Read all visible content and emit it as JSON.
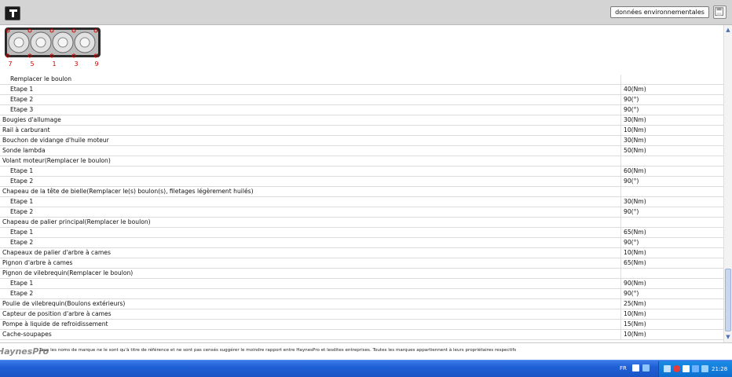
{
  "toolbar": {
    "env_button_label": "données environnementales",
    "logo_icon": "haynes-logo-icon",
    "save_icon": "save-icon"
  },
  "diagram": {
    "labels": [
      "7",
      "5",
      "1",
      "3",
      "9"
    ]
  },
  "rows": [
    {
      "name": "Remplacer le boulon",
      "value": "",
      "sub": true
    },
    {
      "name": "Etape 1",
      "value": "40(Nm)",
      "sub": true
    },
    {
      "name": "Etape 2",
      "value": "90(°)",
      "sub": true
    },
    {
      "name": "Etape 3",
      "value": "90(°)",
      "sub": true
    },
    {
      "name": "Bougies d'allumage",
      "value": "30(Nm)",
      "sub": false
    },
    {
      "name": "Rail à carburant",
      "value": "10(Nm)",
      "sub": false
    },
    {
      "name": "Bouchon de vidange d'huile moteur",
      "value": "30(Nm)",
      "sub": false
    },
    {
      "name": "Sonde lambda",
      "value": "50(Nm)",
      "sub": false
    },
    {
      "name": "Volant moteur(Remplacer le boulon)",
      "value": "",
      "sub": false
    },
    {
      "name": "Etape 1",
      "value": "60(Nm)",
      "sub": true
    },
    {
      "name": "Etape 2",
      "value": "90(°)",
      "sub": true
    },
    {
      "name": "Chapeau de la tête de bielle(Remplacer le(s) boulon(s), filetages légèrement huilés)",
      "value": "",
      "sub": false
    },
    {
      "name": "Etape 1",
      "value": "30(Nm)",
      "sub": true
    },
    {
      "name": "Etape 2",
      "value": "90(°)",
      "sub": true
    },
    {
      "name": "Chapeau de palier principal(Remplacer le boulon)",
      "value": "",
      "sub": false
    },
    {
      "name": "Etape 1",
      "value": "65(Nm)",
      "sub": true
    },
    {
      "name": "Etape 2",
      "value": "90(°)",
      "sub": true
    },
    {
      "name": "Chapeaux de palier d'arbre à cames",
      "value": "10(Nm)",
      "sub": false
    },
    {
      "name": "Pignon d'arbre à cames",
      "value": "65(Nm)",
      "sub": false
    },
    {
      "name": "Pignon de vilebrequin(Remplacer le boulon)",
      "value": "",
      "sub": false
    },
    {
      "name": "Etape 1",
      "value": "90(Nm)",
      "sub": true
    },
    {
      "name": "Etape 2",
      "value": "90(°)",
      "sub": true
    },
    {
      "name": "Poulie de vilebrequin(Boulons extérieurs)",
      "value": "25(Nm)",
      "sub": false
    },
    {
      "name": "Capteur de position d'arbre à cames",
      "value": "10(Nm)",
      "sub": false
    },
    {
      "name": "Pompe à liquide de refroidissement",
      "value": "15(Nm)",
      "sub": false
    },
    {
      "name": "Cache-soupapes",
      "value": "10(Nm)",
      "sub": false
    }
  ],
  "footer": {
    "brand": "HaynesPro",
    "disclaimer": "Tous les noms de marque ne le sont qu'à titre de référence et ne sont pas censés suggérer le moindre rapport entre HaynesPro et lesdites entreprises. Toutes les marques appartiennent à leurs propriétaires respectifs"
  },
  "taskbar": {
    "language": "FR",
    "clock": "21:28"
  },
  "colors": {
    "toolbar_bg": "#d4d4d4",
    "taskbar_blue": "#1f5fd6",
    "diagram_red": "#d40000"
  }
}
